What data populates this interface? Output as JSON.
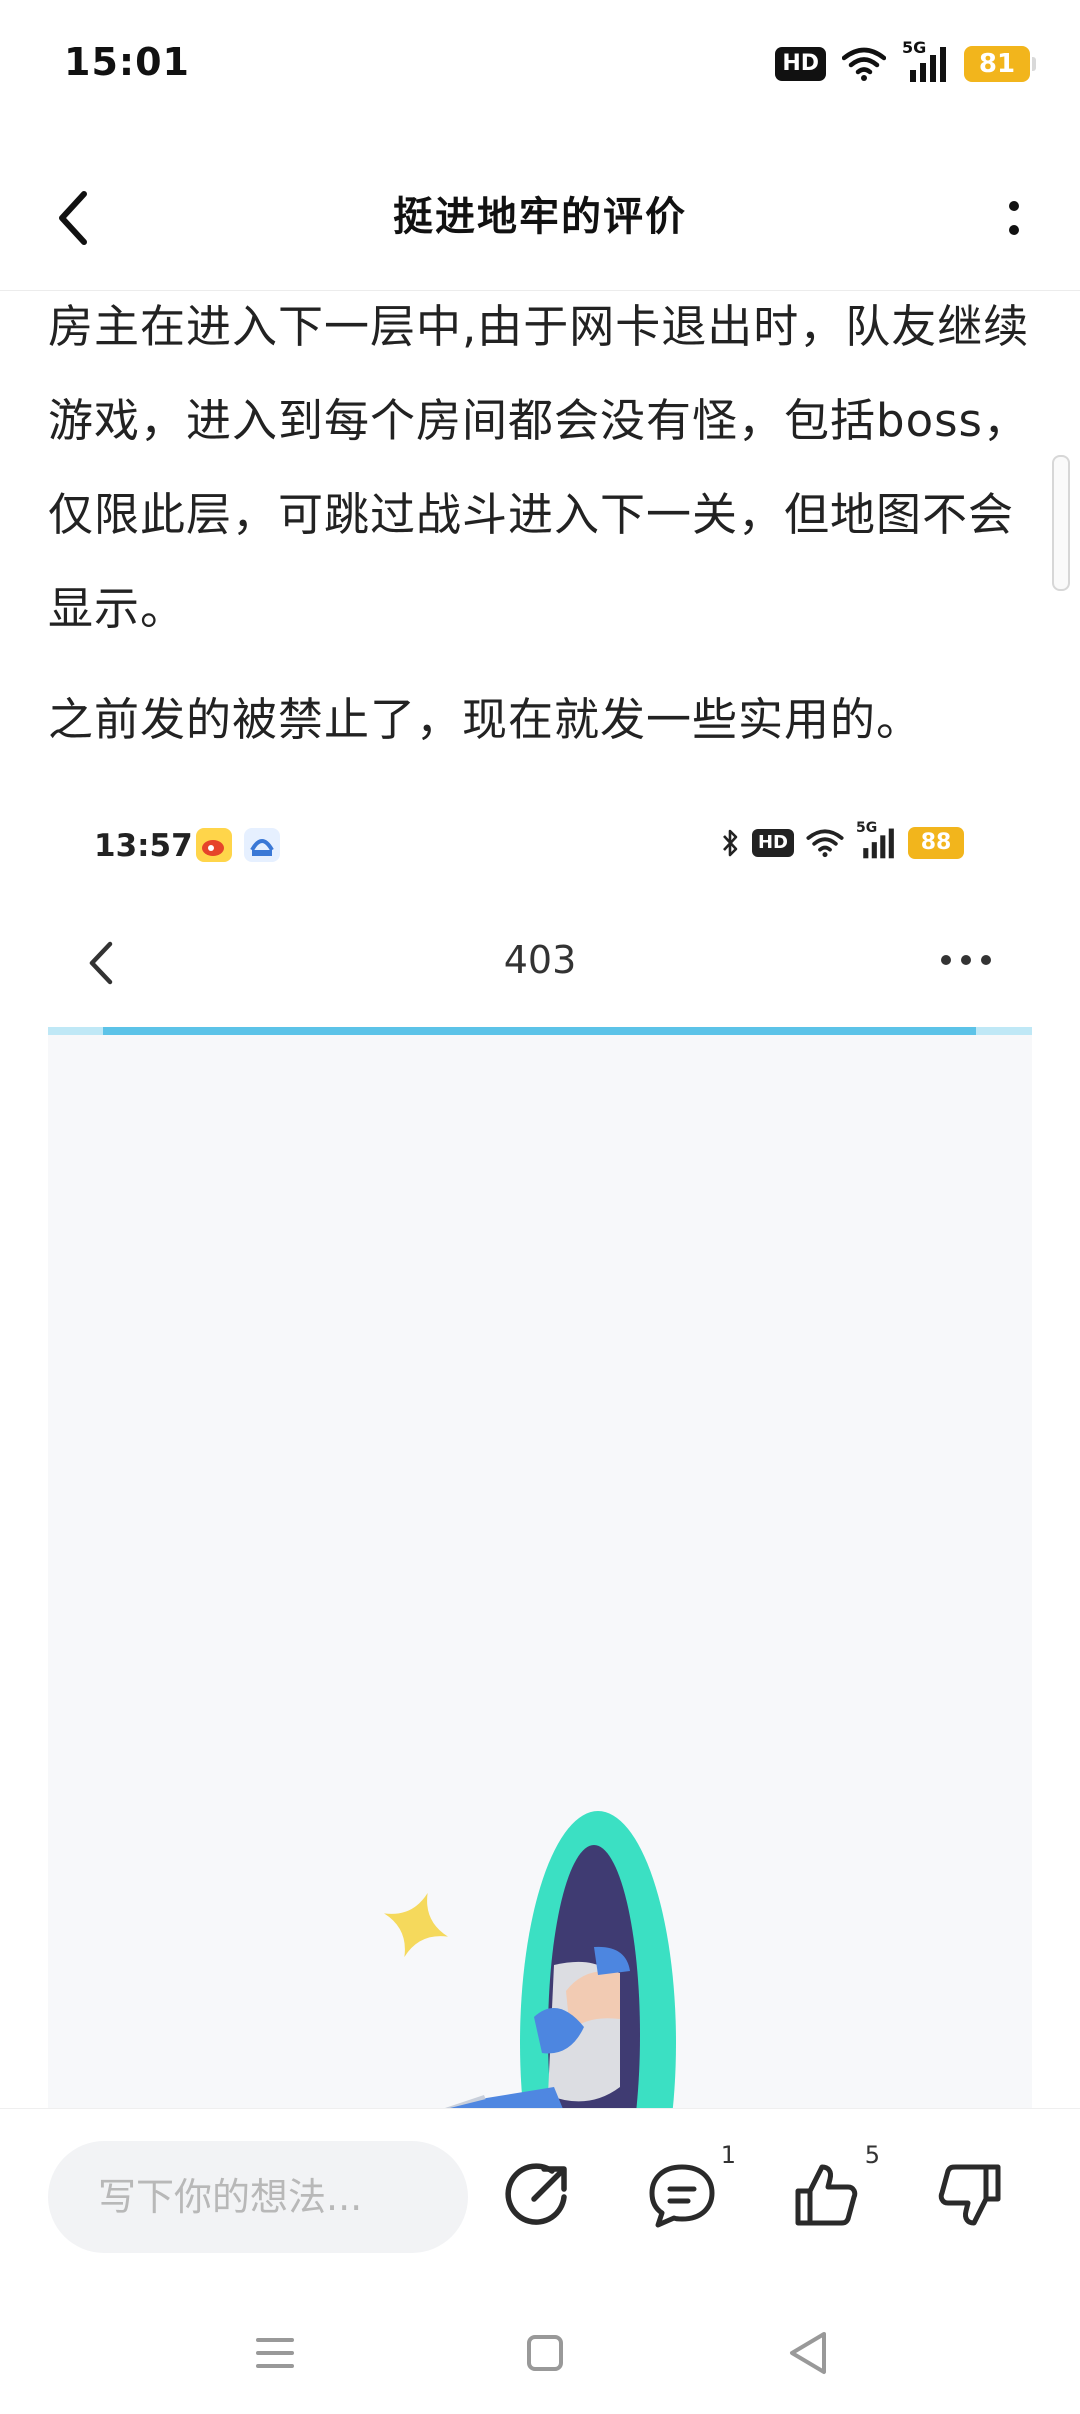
{
  "status_bar": {
    "time": "15:01",
    "hd": "HD",
    "network": "5G",
    "battery": "81",
    "battery_color": "#f2b51c"
  },
  "nav": {
    "title": "挺进地牢的评价",
    "back_icon": "chevron-left-icon",
    "more_icon": "more-vertical-icon"
  },
  "article": {
    "paragraph_1": "房主在进入下一层中,由于网卡退出时，队友继续游戏，进入到每个房间都会没有怪，包括boss，仅限此层，可跳过战斗进入下一关，但地图不会显示。",
    "paragraph_2": "之前发的被禁止了，现在就发一些实用的。"
  },
  "embedded_screenshot": {
    "status_bar": {
      "time": "13:57",
      "hd": "HD",
      "network": "5G",
      "battery": "88"
    },
    "nav": {
      "title": "403",
      "more_icon": "more-horizontal-icon"
    },
    "progress_fraction": 0.94,
    "accent_color": "#5cc3e8",
    "illustration": "character-stepping-through-portal"
  },
  "bottom_bar": {
    "comment_placeholder": "写下你的想法...",
    "share_icon": "share-icon",
    "comment_icon": "comment-icon",
    "comment_count": "1",
    "like_icon": "thumbs-up-icon",
    "like_count": "5",
    "dislike_icon": "thumbs-down-icon"
  },
  "system_nav": {
    "menu_icon": "menu-icon",
    "home_icon": "home-square-icon",
    "back_icon": "back-triangle-icon"
  }
}
